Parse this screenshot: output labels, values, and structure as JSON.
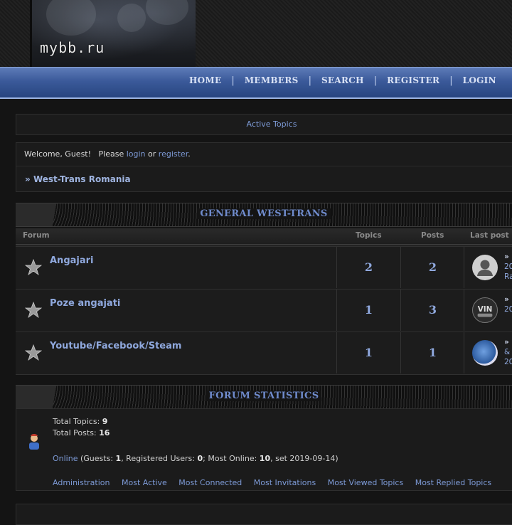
{
  "header": {
    "logo_text": "mybb.ru"
  },
  "nav": {
    "items": [
      "HOME",
      "MEMBERS",
      "SEARCH",
      "REGISTER",
      "LOGIN"
    ],
    "separator": "|"
  },
  "active_topics": "Active Topics",
  "welcome": {
    "greeting": "Welcome, Guest!",
    "please": "Please",
    "login": "login",
    "or": "or",
    "register": "register",
    "period": ".",
    "breadcrumb_prefix": "»",
    "breadcrumb": "West-Trans Romania"
  },
  "category": {
    "title": "GENERAL WEST-TRANS"
  },
  "columns": {
    "forum": "Forum",
    "topics": "Topics",
    "posts": "Posts",
    "last_post": "Last post"
  },
  "forums": [
    {
      "name": "Angajari",
      "topics": "2",
      "posts": "2",
      "last_post_lines": [
        "»",
        "20",
        "Ra"
      ]
    },
    {
      "name": "Poze angajati",
      "topics": "1",
      "posts": "3",
      "last_post_lines": [
        "»",
        "20"
      ]
    },
    {
      "name": "Youtube/Facebook/Steam",
      "topics": "1",
      "posts": "1",
      "last_post_lines": [
        "»",
        "&",
        "20"
      ]
    }
  ],
  "stats": {
    "title": "FORUM STATISTICS",
    "total_topics_label": "Total Topics:",
    "total_topics": "9",
    "total_posts_label": "Total Posts:",
    "total_posts": "16",
    "online_link": "Online",
    "online_open": "(Guests:",
    "guests": "1",
    "registered_label": ", Registered Users:",
    "registered": "0",
    "most_online_label": "; Most Online:",
    "most_online": "10",
    "most_online_date": ", set 2019-09-14)",
    "links": [
      "Administration",
      "Most Active",
      "Most Connected",
      "Most Invitations",
      "Most Viewed Topics",
      "Most Replied Topics"
    ]
  },
  "colors": {
    "accent": "#8fa8dd",
    "nav_blue": "#3b5a9a",
    "category_title": "#6f8bcc"
  }
}
